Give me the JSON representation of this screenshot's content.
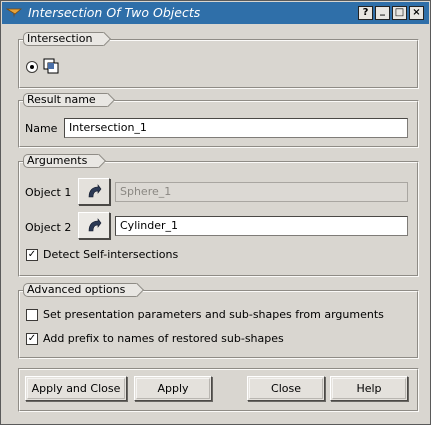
{
  "window": {
    "title": "Intersection Of Two Objects",
    "buttons": {
      "help": "?",
      "minimize": "_",
      "maximize": "□",
      "close": "×"
    }
  },
  "intersection": {
    "group_label": "Intersection",
    "selected": true,
    "icon": "intersection-icon"
  },
  "result_name": {
    "group_label": "Result name",
    "name_label": "Name",
    "name_value": "Intersection_1"
  },
  "arguments": {
    "group_label": "Arguments",
    "object1_label": "Object 1",
    "object1_value": "Sphere_1",
    "object2_label": "Object 2",
    "object2_value": "Cylinder_1",
    "select_icon": "arrow-select-icon",
    "detect_label": "Detect Self-intersections",
    "detect_checked": true
  },
  "advanced": {
    "group_label": "Advanced options",
    "set_presentation_label": "Set presentation parameters and sub-shapes from arguments",
    "set_presentation_checked": false,
    "add_prefix_label": "Add prefix to names of restored sub-shapes",
    "add_prefix_checked": true
  },
  "footer": {
    "apply_close": "Apply and Close",
    "apply": "Apply",
    "close": "Close",
    "help": "Help"
  },
  "colors": {
    "titlebar": "#2f6fa9",
    "background": "#d9d6d0"
  }
}
